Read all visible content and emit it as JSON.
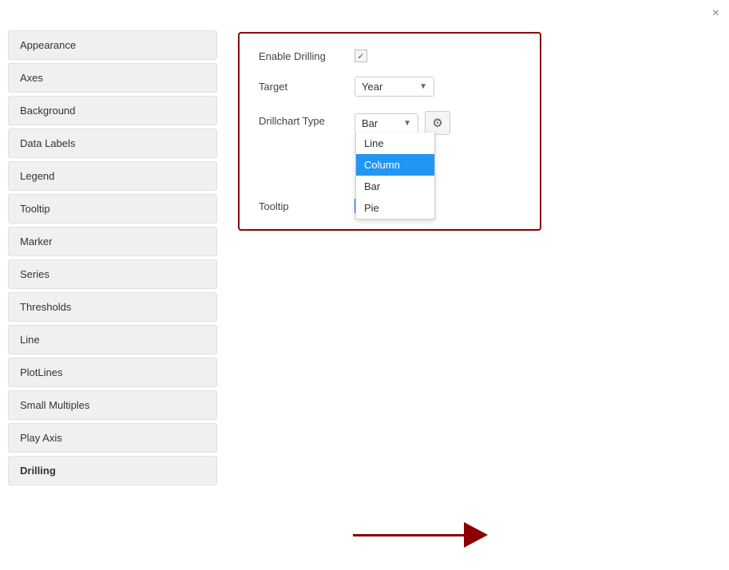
{
  "close_button": "×",
  "sidebar": {
    "items": [
      {
        "id": "appearance",
        "label": "Appearance"
      },
      {
        "id": "axes",
        "label": "Axes"
      },
      {
        "id": "background",
        "label": "Background"
      },
      {
        "id": "data-labels",
        "label": "Data Labels"
      },
      {
        "id": "legend",
        "label": "Legend"
      },
      {
        "id": "tooltip",
        "label": "Tooltip"
      },
      {
        "id": "marker",
        "label": "Marker"
      },
      {
        "id": "series",
        "label": "Series"
      },
      {
        "id": "thresholds",
        "label": "Thresholds"
      },
      {
        "id": "line",
        "label": "Line"
      },
      {
        "id": "plotlines",
        "label": "PlotLines"
      },
      {
        "id": "small-multiples",
        "label": "Small Multiples"
      },
      {
        "id": "play-axis",
        "label": "Play Axis"
      },
      {
        "id": "drilling",
        "label": "Drilling"
      }
    ]
  },
  "panel": {
    "enable_drilling_label": "Enable Drilling",
    "target_label": "Target",
    "target_value": "Year",
    "drillchart_type_label": "Drillchart Type",
    "drillchart_type_value": "Bar",
    "tooltip_label": "Tooltip",
    "dropdown_options": [
      {
        "id": "line",
        "label": "Line",
        "selected": false
      },
      {
        "id": "column",
        "label": "Column",
        "selected": true
      },
      {
        "id": "bar",
        "label": "Bar",
        "selected": false
      },
      {
        "id": "pie",
        "label": "Pie",
        "selected": false
      }
    ]
  }
}
